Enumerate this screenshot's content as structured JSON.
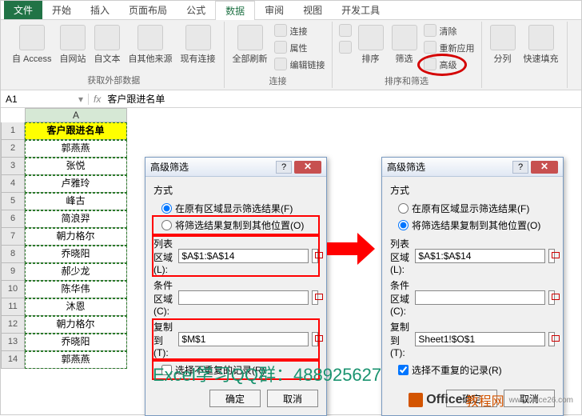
{
  "tabs": {
    "file": "文件",
    "home": "开始",
    "insert": "插入",
    "layout": "页面布局",
    "formula": "公式",
    "data": "数据",
    "review": "审阅",
    "view": "视图",
    "dev": "开发工具"
  },
  "ribbon": {
    "ext_data": {
      "access": "自 Access",
      "web": "自网站",
      "text": "自文本",
      "other": "自其他来源",
      "existing": "现有连接",
      "group": "获取外部数据"
    },
    "connections": {
      "refresh": "全部刷新",
      "conn": "连接",
      "prop": "属性",
      "links": "编辑链接",
      "group": "连接"
    },
    "sort_filter": {
      "sortaz": "A↓Z",
      "sortza": "Z↓A",
      "sort": "排序",
      "filter": "筛选",
      "clear": "清除",
      "reapply": "重新应用",
      "advanced": "高级",
      "group": "排序和筛选"
    },
    "tools": {
      "t2c": "分列",
      "flash": "快速填充"
    }
  },
  "formula_bar": {
    "cell_ref": "A1",
    "fx": "fx",
    "value": "客户跟进名单"
  },
  "sheet": {
    "col": "A",
    "rows": [
      1,
      2,
      3,
      4,
      5,
      6,
      7,
      8,
      9,
      10,
      11,
      12,
      13,
      14
    ],
    "data": [
      "客户跟进名单",
      "郭燕燕",
      "张悦",
      "卢雅玲",
      "峰古",
      "简浪羿",
      "朝力格尔",
      "乔晓阳",
      "郝少龙",
      "陈华伟",
      "沐恩",
      "朝力格尔",
      "乔晓阳",
      "郭燕燕"
    ]
  },
  "dlg": {
    "title": "高级筛选",
    "mode_label": "方式",
    "radio_in_place": "在原有区域显示筛选结果(F)",
    "radio_copy": "将筛选结果复制到其他位置(O)",
    "list_range_label": "列表区域(L):",
    "criteria_label": "条件区域(C):",
    "copy_to_label": "复制到(T):",
    "unique_label": "选择不重复的记录(R)",
    "ok": "确定",
    "cancel": "取消"
  },
  "dlg_left": {
    "list_range": "$A$1:$A$14",
    "criteria": "",
    "copy_to": "$M$1"
  },
  "dlg_right": {
    "list_range": "$A$1:$A$14",
    "criteria": "",
    "copy_to": "Sheet1!$O$1"
  },
  "promo": "Excel学习QQ群：488925627",
  "watermark": {
    "brand1": "Office",
    "brand2": "教程网",
    "url": "www.office26.com"
  }
}
